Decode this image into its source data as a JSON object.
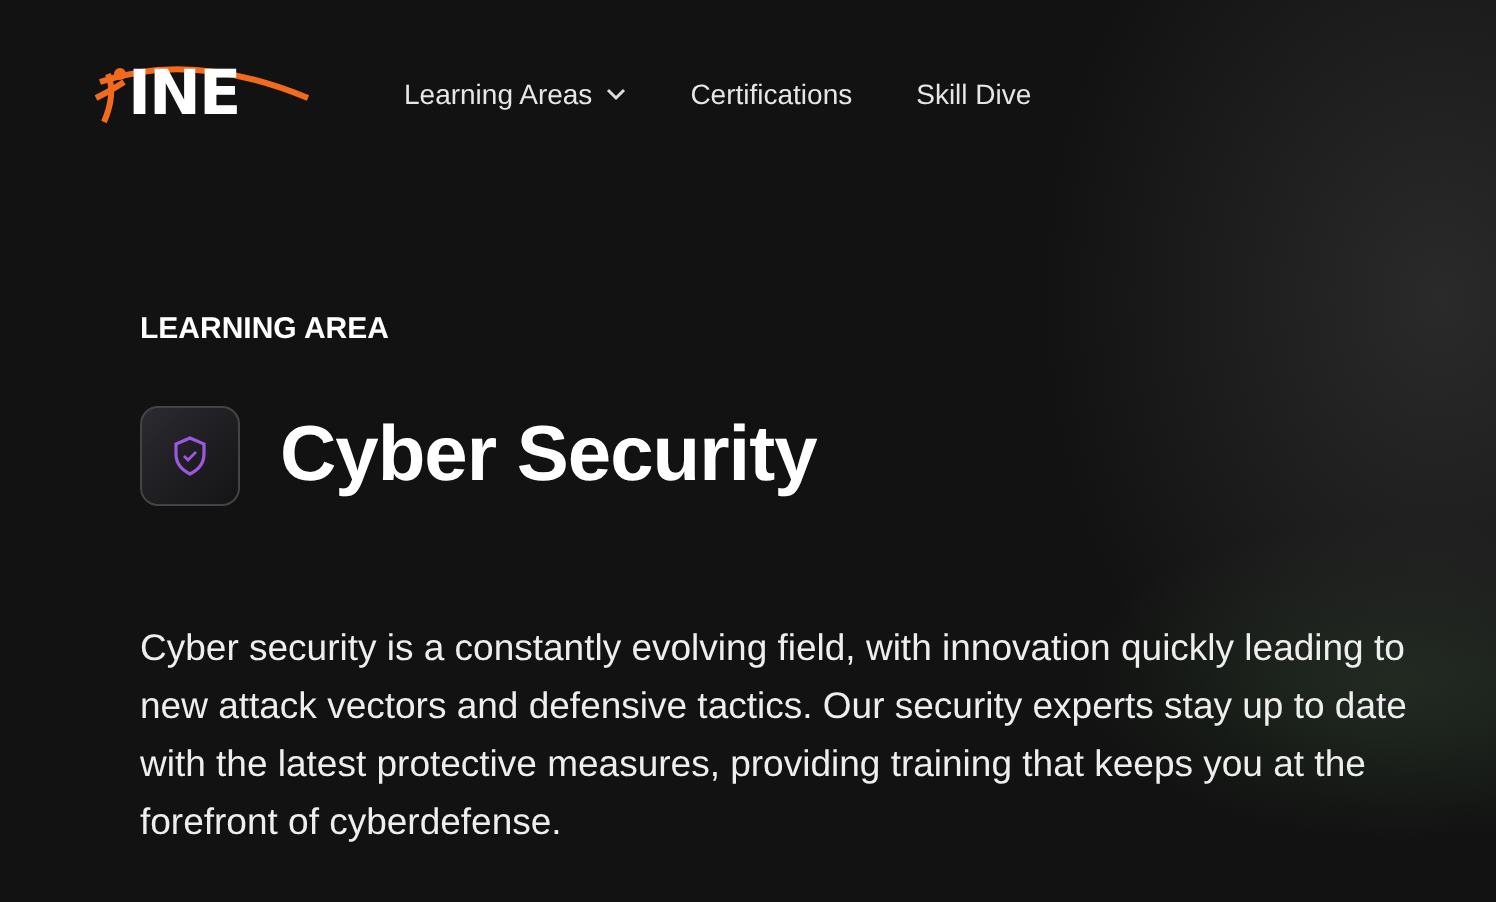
{
  "logo": {
    "text": "INE"
  },
  "nav": [
    {
      "label": "Learning Areas",
      "dropdown": true
    },
    {
      "label": "Certifications",
      "dropdown": false
    },
    {
      "label": "Skill Dive",
      "dropdown": false
    }
  ],
  "eyebrow": "LEARNING AREA",
  "heading": "Cyber Security",
  "description": "Cyber security is a constantly evolving field, with innovation quickly leading to new attack vectors and defensive tactics. Our security experts stay up to date with the latest protective measures, providing training that keeps you at the forefront of cyberdefense."
}
